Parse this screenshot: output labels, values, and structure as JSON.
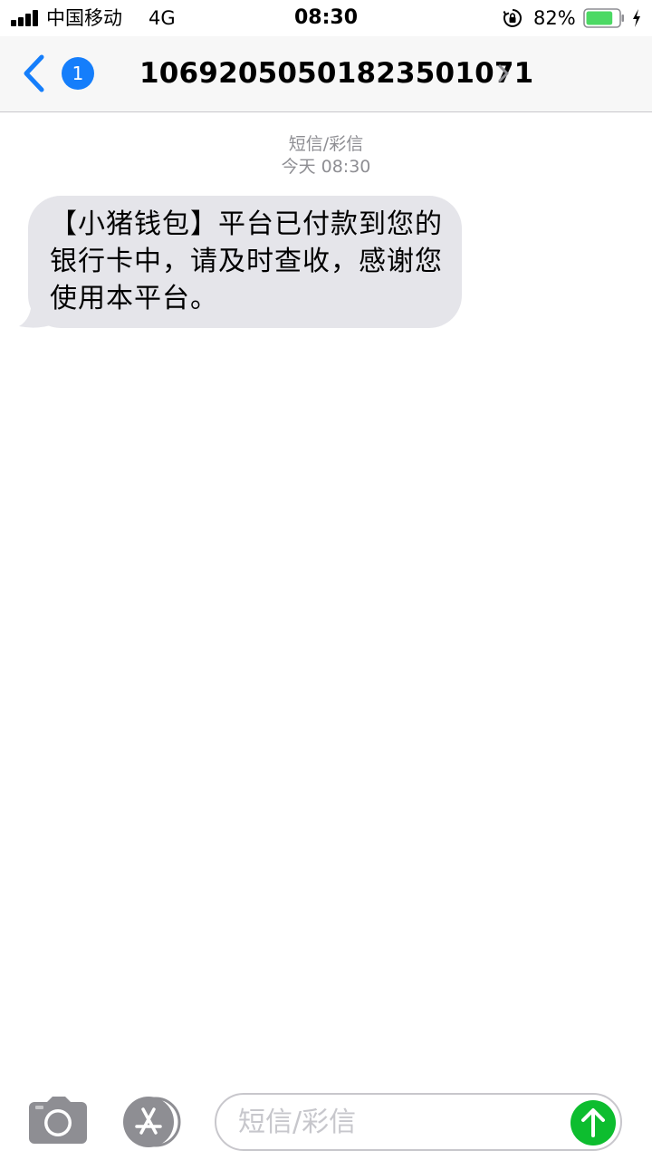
{
  "status_bar": {
    "carrier": "中国移动",
    "network": "4G",
    "time": "08:30",
    "battery_percent": "82%",
    "battery_level": 0.82,
    "icons": [
      "signal-icon",
      "orientation-lock-icon",
      "battery-icon",
      "charging-bolt-icon"
    ]
  },
  "nav": {
    "back_badge": "1",
    "title": "10692050501823501071",
    "icons": [
      "back-chevron-icon",
      "chevron-right-icon"
    ]
  },
  "conversation": {
    "service_label": "短信/彩信",
    "timestamp": "今天 08:30",
    "messages": [
      {
        "direction": "incoming",
        "text": "【小猪钱包】平台已付款到您的银行卡中，请及时查收，感谢您使用本平台。"
      }
    ]
  },
  "input_bar": {
    "placeholder": "短信/彩信",
    "icons": [
      "camera-icon",
      "app-store-icon",
      "send-arrow-icon"
    ]
  },
  "colors": {
    "accent": "#157efb",
    "bubble_incoming": "#e5e5ea",
    "send_green": "#0dbd2f",
    "battery_green": "#4cd964",
    "secondary_text": "#8e8e93",
    "icon_gray": "#8e8e93"
  }
}
